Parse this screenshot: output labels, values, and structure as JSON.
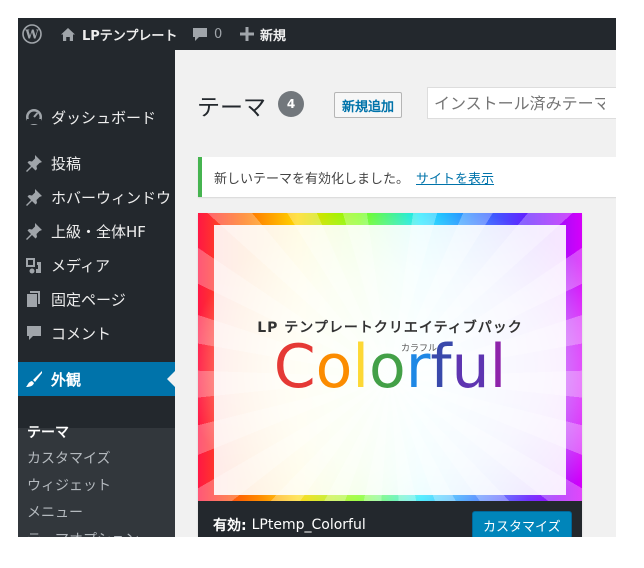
{
  "admin_bar": {
    "wp_logo_icon": "wordpress-logo-icon",
    "site_icon": "home-icon",
    "site_name": "LPテンプレート",
    "comments_icon": "comment-bubble-icon",
    "comments_count": "0",
    "new_icon": "plus-icon",
    "new_label": "新規"
  },
  "sidebar": {
    "items": [
      {
        "label": "ダッシュボード",
        "icon": "dashboard-icon"
      },
      {
        "label": "投稿",
        "icon": "pin-icon"
      },
      {
        "label": "ホバーウィンドウ",
        "icon": "pin-icon"
      },
      {
        "label": "上級・全体HF",
        "icon": "pin-icon"
      },
      {
        "label": "メディア",
        "icon": "media-icon"
      },
      {
        "label": "固定ページ",
        "icon": "pages-icon"
      },
      {
        "label": "コメント",
        "icon": "comment-icon"
      },
      {
        "label": "外観",
        "icon": "paintbrush-icon"
      }
    ],
    "submenu": [
      {
        "label": "テーマ"
      },
      {
        "label": "カスタマイズ"
      },
      {
        "label": "ウィジェット"
      },
      {
        "label": "メニュー"
      },
      {
        "label": "テーマオプション"
      }
    ]
  },
  "main": {
    "title": "テーマ",
    "count": "4",
    "add_new": "新規追加",
    "search_placeholder": "インストール済みテーマを検索...",
    "notice": {
      "text": "新しいテーマを有効化しました。",
      "link": "サイトを表示"
    }
  },
  "theme": {
    "tagline": "LP テンプレートクリエイティブパック",
    "logo_letters": [
      "C",
      "o",
      "l",
      "o",
      "r",
      "f",
      "u",
      "l"
    ],
    "logo_ruby": "カラフル",
    "active_label": "有効:",
    "name": "LPtemp_Colorful",
    "customize": "カスタマイズ"
  },
  "colors": {
    "admin_dark": "#23282d",
    "accent_blue": "#0073aa",
    "notice_green": "#46b450",
    "button_blue": "#0085ba",
    "logo": [
      "#e53935",
      "#fb8c00",
      "#fdd835",
      "#43a047",
      "#1e88e5",
      "#3949ab",
      "#5e35b1",
      "#8e24aa"
    ]
  }
}
